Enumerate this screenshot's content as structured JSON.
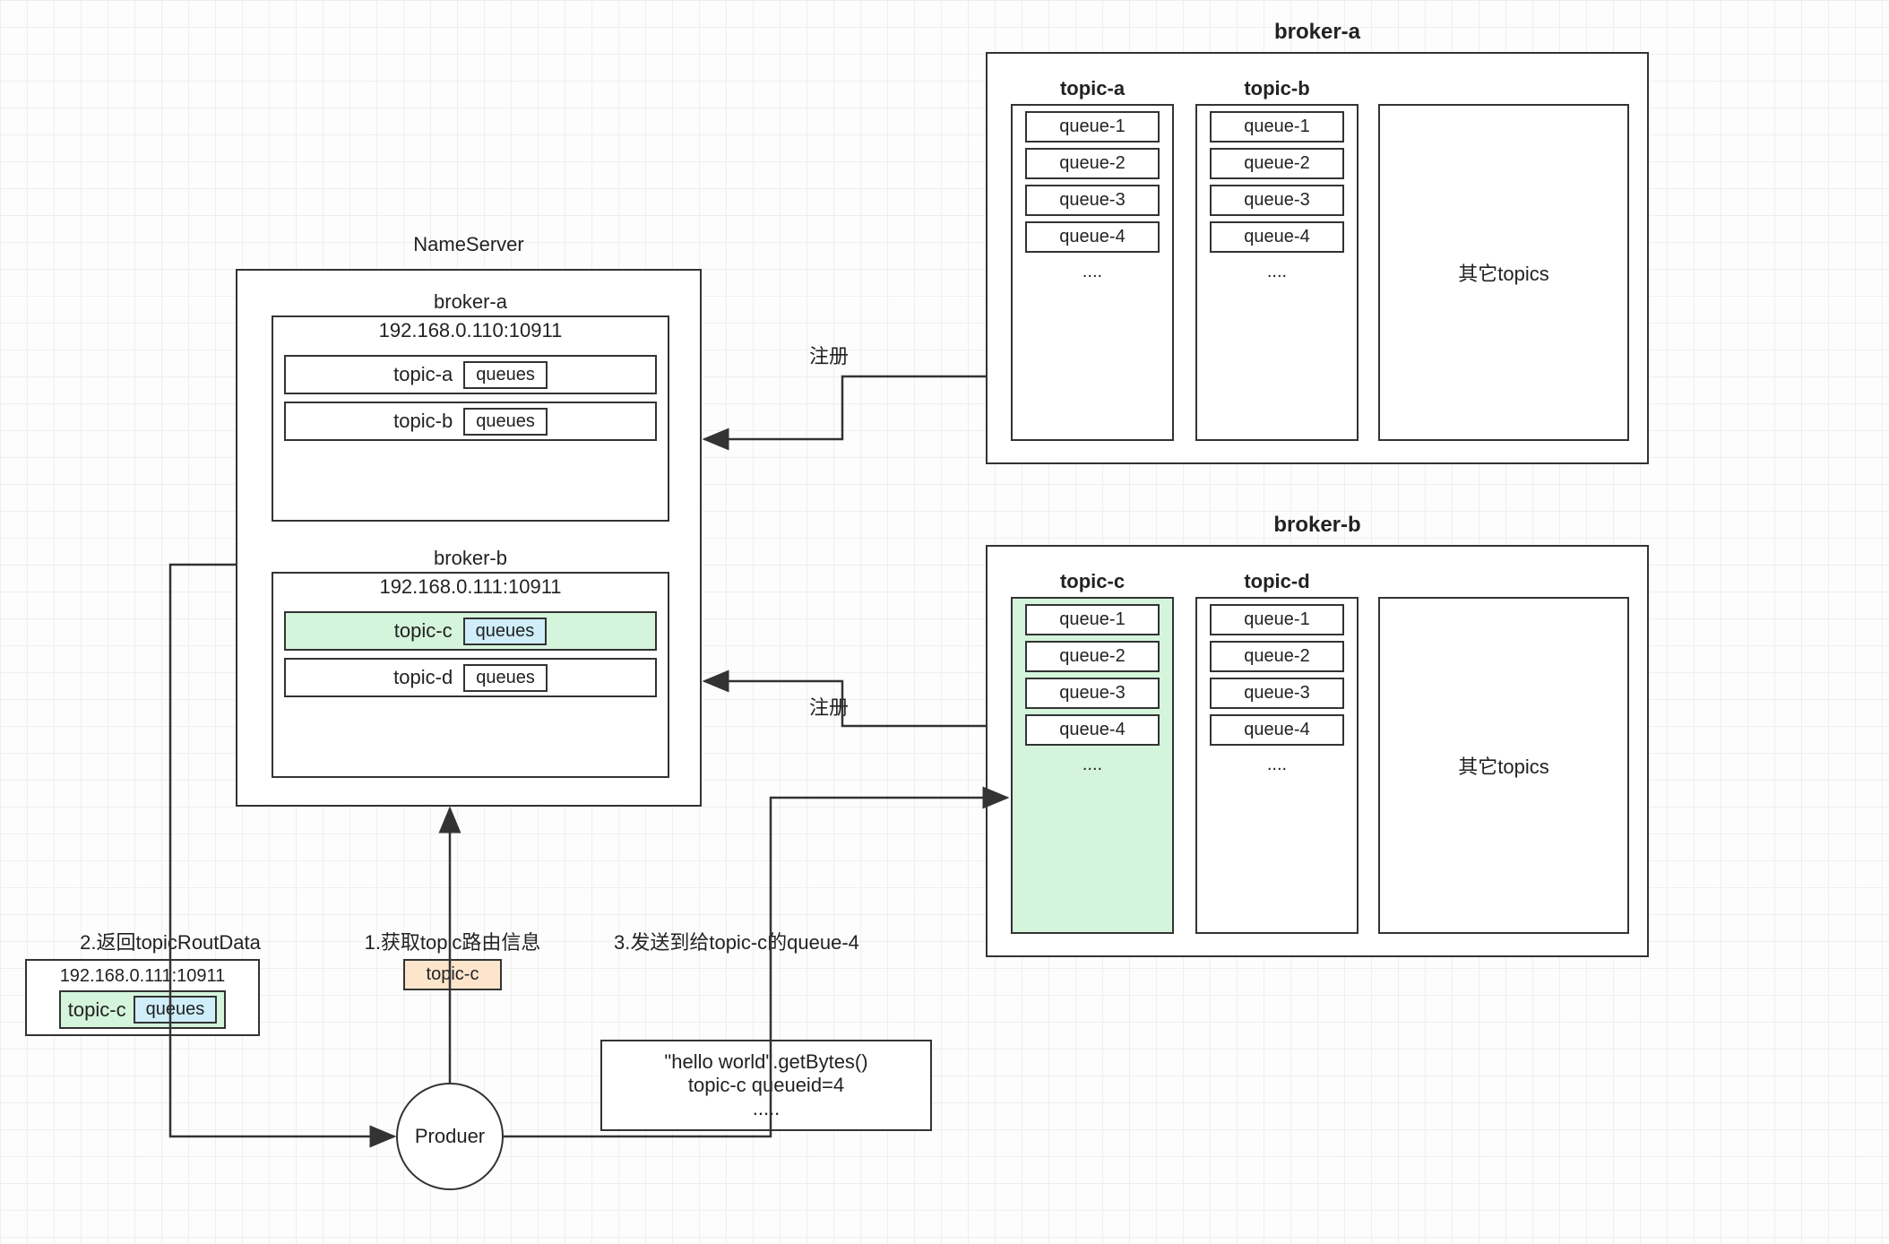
{
  "nameserver": {
    "title": "NameServer",
    "brokers": [
      {
        "name": "broker-a",
        "ip": "192.168.0.110:10911",
        "topics": [
          {
            "name": "topic-a",
            "queues_label": "queues",
            "highlight": false
          },
          {
            "name": "topic-b",
            "queues_label": "queues",
            "highlight": false
          }
        ]
      },
      {
        "name": "broker-b",
        "ip": "192.168.0.111:10911",
        "topics": [
          {
            "name": "topic-c",
            "queues_label": "queues",
            "highlight": true
          },
          {
            "name": "topic-d",
            "queues_label": "queues",
            "highlight": false
          }
        ]
      }
    ]
  },
  "brokers": [
    {
      "name": "broker-a",
      "topics": [
        {
          "name": "topic-a",
          "queues": [
            "queue-1",
            "queue-2",
            "queue-3",
            "queue-4"
          ],
          "ellipsis": "....",
          "highlight": false
        },
        {
          "name": "topic-b",
          "queues": [
            "queue-1",
            "queue-2",
            "queue-3",
            "queue-4"
          ],
          "ellipsis": "....",
          "highlight": false
        }
      ],
      "other_topics_label": "其它topics",
      "register_label": "注册"
    },
    {
      "name": "broker-b",
      "topics": [
        {
          "name": "topic-c",
          "queues": [
            "queue-1",
            "queue-2",
            "queue-3",
            "queue-4"
          ],
          "ellipsis": "....",
          "highlight": true
        },
        {
          "name": "topic-d",
          "queues": [
            "queue-1",
            "queue-2",
            "queue-3",
            "queue-4"
          ],
          "ellipsis": "....",
          "highlight": false
        }
      ],
      "other_topics_label": "其它topics",
      "register_label": "注册"
    }
  ],
  "producer": {
    "label": "Produer"
  },
  "steps": {
    "step1_label": "1.获取topic路由信息",
    "step1_topic": "topic-c",
    "step2_label": "2.返回topicRoutData",
    "step2_ip": "192.168.0.111:10911",
    "step2_topic": "topic-c",
    "step2_queues": "queues",
    "step3_label": "3.发送到给topic-c的queue-4"
  },
  "message": {
    "line1": "\"hello world\".getBytes()",
    "line2": "topic-c    queueid=4",
    "line3": "....."
  }
}
